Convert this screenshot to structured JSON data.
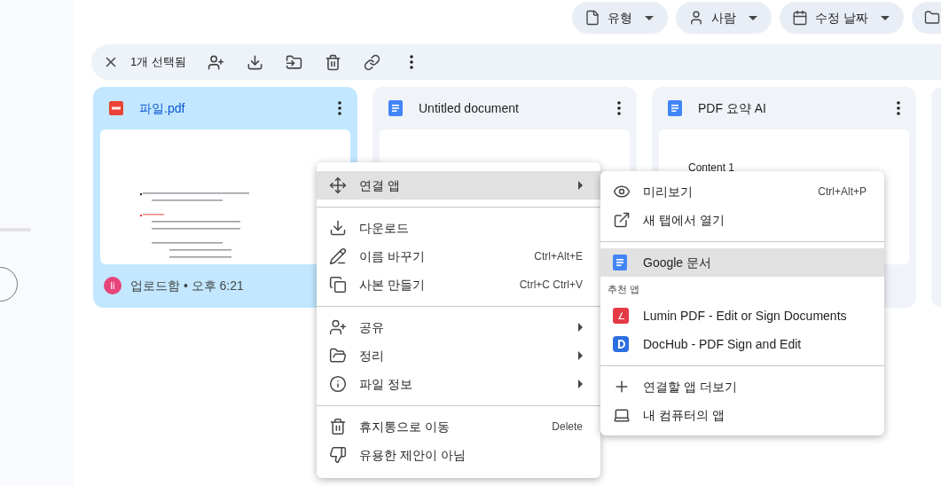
{
  "filters": [
    {
      "kind": "type",
      "label": "유형"
    },
    {
      "kind": "people",
      "label": "사람"
    },
    {
      "kind": "modified",
      "label": "수정 날짜"
    },
    {
      "kind": "folder"
    }
  ],
  "selection_bar": {
    "count": "1개 선택됨"
  },
  "files": [
    {
      "kind": "pdf",
      "name": "파일.pdf",
      "selected": true,
      "owner_initial": "li",
      "activity": "업로드함 • 오후 6:21"
    },
    {
      "kind": "doc",
      "name": "Untitled document",
      "selected": false
    },
    {
      "kind": "doc",
      "name": "PDF 요약 AI",
      "selected": false,
      "preview_text": "Content 1"
    }
  ],
  "context_menu": [
    {
      "kind": "item",
      "label": "연결 앱",
      "submenu": true,
      "selected": true
    },
    {
      "kind": "divider"
    },
    {
      "kind": "item",
      "label": "다운로드",
      "submenu": false,
      "selected": false
    },
    {
      "kind": "item",
      "label": "이름 바꾸기",
      "shortcut": "Ctrl+Alt+E",
      "submenu": false,
      "selected": false
    },
    {
      "kind": "item",
      "label": "사본 만들기",
      "shortcut": "Ctrl+C Ctrl+V",
      "submenu": false,
      "selected": false
    },
    {
      "kind": "divider"
    },
    {
      "kind": "item",
      "label": "공유",
      "submenu": true,
      "selected": false
    },
    {
      "kind": "item",
      "label": "정리",
      "submenu": true,
      "selected": false
    },
    {
      "kind": "item",
      "label": "파일 정보",
      "submenu": true,
      "selected": false
    },
    {
      "kind": "divider"
    },
    {
      "kind": "item",
      "label": "휴지통으로 이동",
      "shortcut": "Delete",
      "submenu": false,
      "selected": false
    },
    {
      "kind": "item",
      "label": "유용한 제안이 아님",
      "submenu": false,
      "selected": false
    }
  ],
  "open_with_menu": [
    {
      "kind": "item",
      "label": "미리보기",
      "shortcut": "Ctrl+Alt+P",
      "selected": false
    },
    {
      "kind": "item",
      "label": "새 탭에서 열기",
      "selected": false
    },
    {
      "kind": "divider"
    },
    {
      "kind": "item",
      "label": "Google 문서",
      "selected": true
    },
    {
      "kind": "heading",
      "label": "추천 앱"
    },
    {
      "kind": "item",
      "label": "Lumin PDF - Edit or Sign Documents",
      "selected": false
    },
    {
      "kind": "item",
      "label": "DocHub - PDF Sign and Edit",
      "selected": false
    },
    {
      "kind": "divider"
    },
    {
      "kind": "item",
      "label": "연결할 앱 더보기",
      "selected": false
    },
    {
      "kind": "item",
      "label": "내 컴퓨터의 앱",
      "selected": false
    }
  ]
}
